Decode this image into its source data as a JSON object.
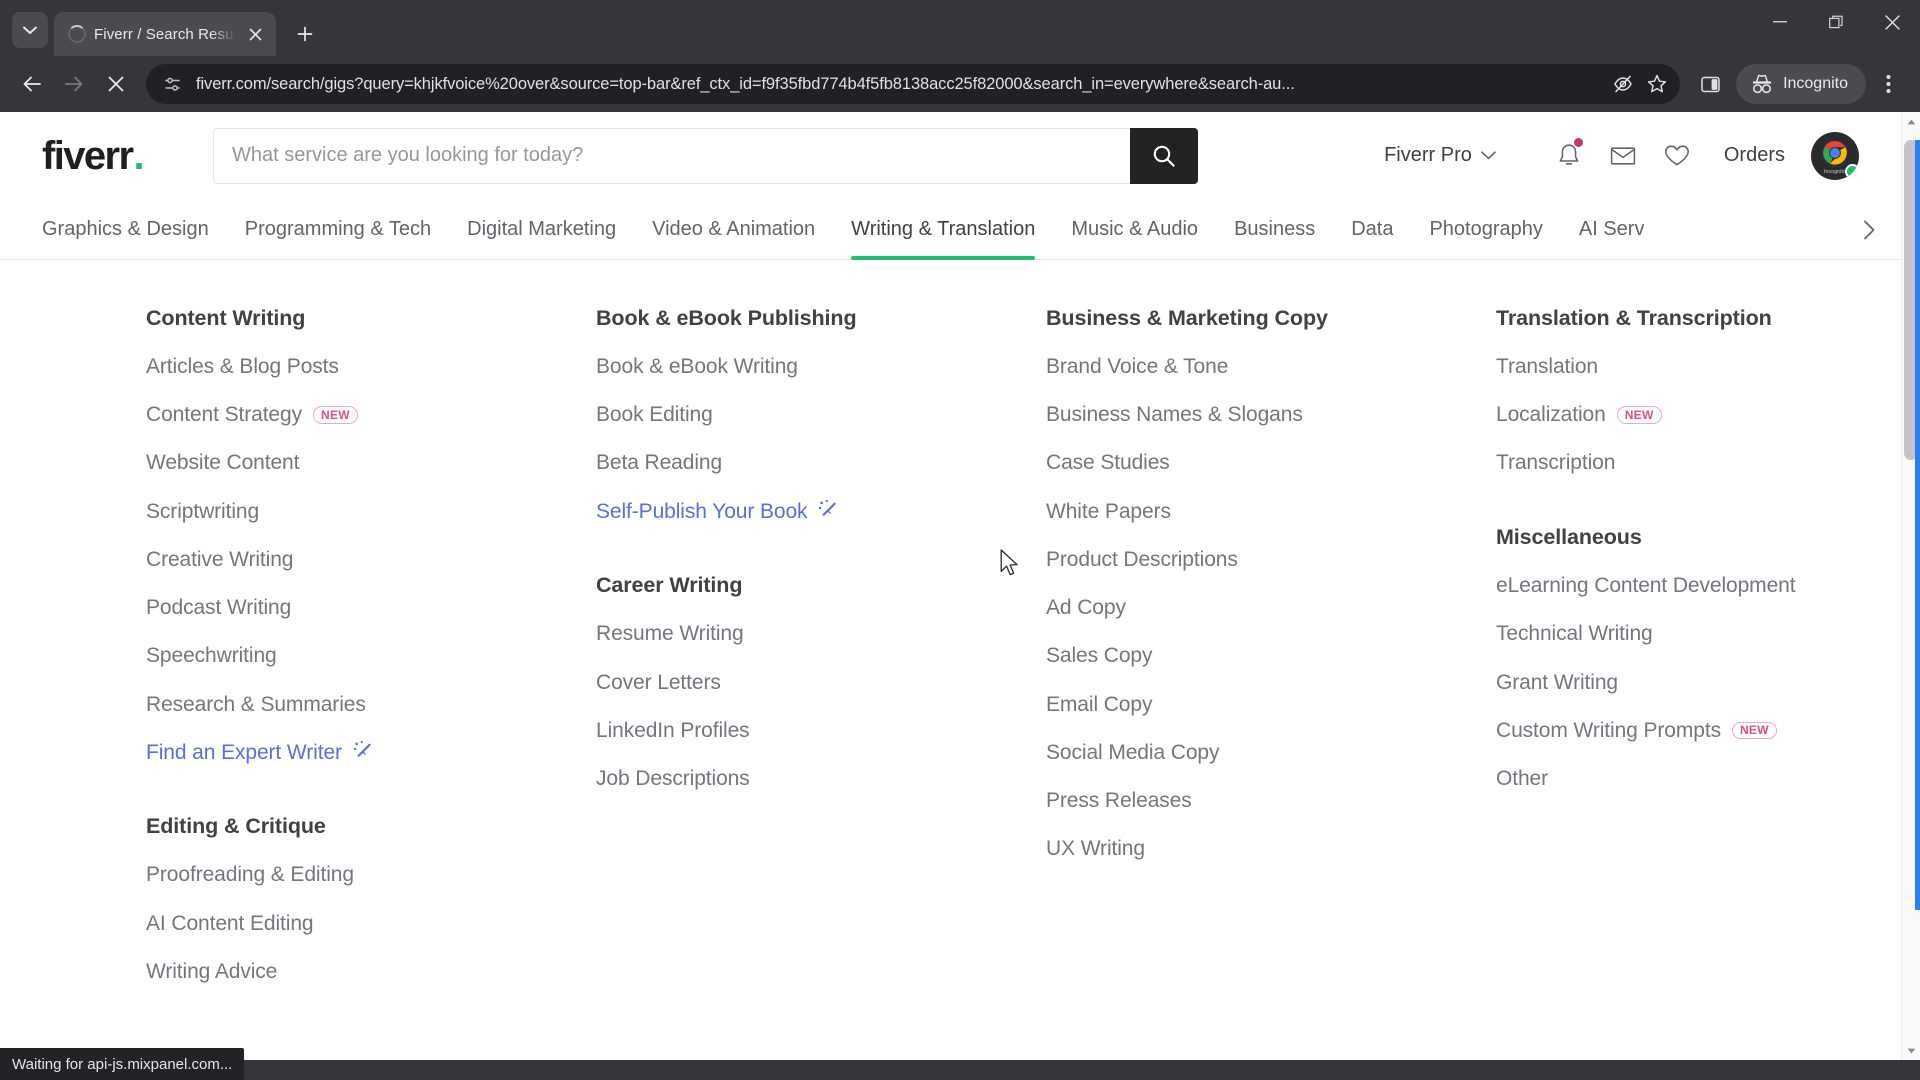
{
  "browser": {
    "tab": {
      "title": "Fiverr / Search Results for 'khjkf",
      "loading": true
    },
    "new_tab_label": "+",
    "address": "fiverr.com/search/gigs?query=khjkfvoice%20over&source=top-bar&ref_ctx_id=f9f35fbd774b4f5fb8138acc25f82000&search_in=everywhere&search-au...",
    "profile_label": "Incognito",
    "status_text": "Waiting for api-js.mixpanel.com..."
  },
  "site": {
    "logo": "fiverr",
    "logo_dot": ".",
    "search": {
      "placeholder": "What service are you looking for today?",
      "value": ""
    },
    "pro_label": "Fiverr Pro",
    "orders_label": "Orders",
    "categories": [
      {
        "label": "Graphics & Design",
        "active": false
      },
      {
        "label": "Programming & Tech",
        "active": false
      },
      {
        "label": "Digital Marketing",
        "active": false
      },
      {
        "label": "Video & Animation",
        "active": false
      },
      {
        "label": "Writing & Translation",
        "active": true
      },
      {
        "label": "Music & Audio",
        "active": false
      },
      {
        "label": "Business",
        "active": false
      },
      {
        "label": "Data",
        "active": false
      },
      {
        "label": "Photography",
        "active": false
      },
      {
        "label": "AI Serv",
        "active": false
      }
    ]
  },
  "mega_menu": {
    "columns": [
      {
        "groups": [
          {
            "heading": "Content Writing",
            "items": [
              {
                "label": "Articles & Blog Posts"
              },
              {
                "label": "Content Strategy",
                "badge": "NEW"
              },
              {
                "label": "Website Content"
              },
              {
                "label": "Scriptwriting"
              },
              {
                "label": "Creative Writing"
              },
              {
                "label": "Podcast Writing"
              },
              {
                "label": "Speechwriting"
              },
              {
                "label": "Research & Summaries"
              },
              {
                "label": "Find an Expert Writer",
                "link": true,
                "icon": "magic-wand-icon"
              }
            ]
          },
          {
            "heading": "Editing & Critique",
            "items": [
              {
                "label": "Proofreading & Editing"
              },
              {
                "label": "AI Content Editing"
              },
              {
                "label": "Writing Advice"
              }
            ]
          }
        ]
      },
      {
        "groups": [
          {
            "heading": "Book & eBook Publishing",
            "items": [
              {
                "label": "Book & eBook Writing"
              },
              {
                "label": "Book Editing"
              },
              {
                "label": "Beta Reading"
              },
              {
                "label": "Self-Publish Your Book",
                "link": true,
                "icon": "magic-wand-icon"
              }
            ]
          },
          {
            "heading": "Career Writing",
            "items": [
              {
                "label": "Resume Writing"
              },
              {
                "label": "Cover Letters"
              },
              {
                "label": "LinkedIn Profiles"
              },
              {
                "label": "Job Descriptions"
              }
            ]
          }
        ]
      },
      {
        "groups": [
          {
            "heading": "Business & Marketing Copy",
            "items": [
              {
                "label": "Brand Voice & Tone"
              },
              {
                "label": "Business Names & Slogans"
              },
              {
                "label": "Case Studies"
              },
              {
                "label": "White Papers"
              },
              {
                "label": "Product Descriptions"
              },
              {
                "label": "Ad Copy"
              },
              {
                "label": "Sales Copy"
              },
              {
                "label": "Email Copy"
              },
              {
                "label": "Social Media Copy"
              },
              {
                "label": "Press Releases"
              },
              {
                "label": "UX Writing"
              }
            ]
          }
        ]
      },
      {
        "groups": [
          {
            "heading": "Translation & Transcription",
            "items": [
              {
                "label": "Translation"
              },
              {
                "label": "Localization",
                "badge": "NEW"
              },
              {
                "label": "Transcription"
              }
            ]
          },
          {
            "heading": "Miscellaneous",
            "items": [
              {
                "label": "eLearning Content Development"
              },
              {
                "label": "Technical Writing"
              },
              {
                "label": "Grant Writing"
              },
              {
                "label": "Custom Writing Prompts",
                "badge": "NEW"
              },
              {
                "label": "Other"
              }
            ]
          }
        ]
      }
    ]
  },
  "colors": {
    "brand_green": "#1dbf73",
    "badge_pink": "#e04f7a",
    "link_blue": "#5a6ee0",
    "notification_red": "#c4385c",
    "chrome_dark": "#35363a"
  }
}
